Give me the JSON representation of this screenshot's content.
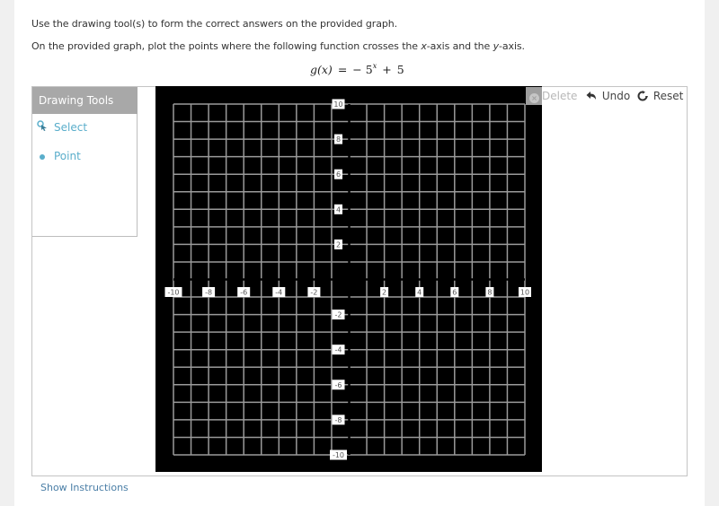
{
  "instructions": {
    "line1": "Use the drawing tool(s) to form the correct answers on the provided graph.",
    "line2_prefix": "On the provided graph, plot the points where the following function crosses the ",
    "line2_x": "x",
    "line2_mid": "-axis and the ",
    "line2_y": "y",
    "line2_suffix": "-axis."
  },
  "equation": {
    "lhs": "g(x)",
    "equals": "=",
    "minus": "−",
    "base": "5",
    "exponent": "x",
    "plus": "+",
    "constant": "5"
  },
  "drawing_tools": {
    "title": "Drawing Tools",
    "items": [
      {
        "label": "Select",
        "icon": "select-cursor-icon"
      },
      {
        "label": "Point",
        "icon": "point-dot-icon"
      }
    ]
  },
  "toolbar": {
    "delete_label": "Delete",
    "undo_label": "Undo",
    "reset_label": "Reset",
    "delete_enabled": false
  },
  "graph": {
    "x_range": [
      -10,
      10
    ],
    "y_range": [
      -10,
      10
    ],
    "grid_step": 1,
    "label_step": 2,
    "x_tick_labels": [
      "-10",
      "-8",
      "-6",
      "-4",
      "-2",
      "2",
      "4",
      "6",
      "8",
      "10"
    ],
    "y_tick_labels": [
      "10",
      "8",
      "6",
      "4",
      "2",
      "-2",
      "-4",
      "-6",
      "-8",
      "-10"
    ],
    "colors": {
      "background": "#000000",
      "grid": "#9a9a9a",
      "axis": "#000000",
      "label_bg": "#ffffff",
      "label_text": "#555555"
    },
    "plotted_points": []
  },
  "footer": {
    "show_instructions_label": "Show Instructions"
  }
}
